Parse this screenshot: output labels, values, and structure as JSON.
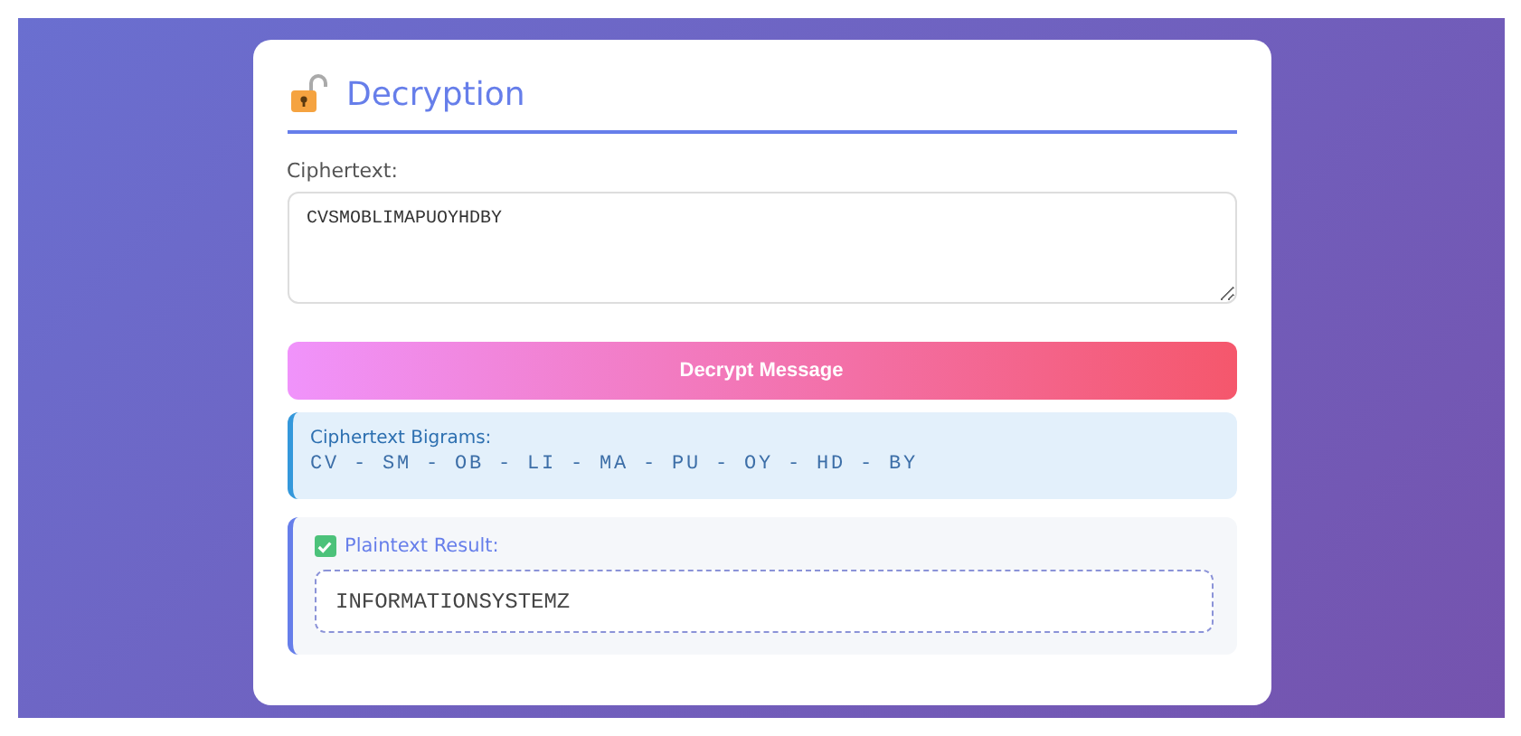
{
  "title": "Decryption",
  "ciphertext": {
    "label": "Ciphertext:",
    "value": "CVSMOBLIMAPUOYHDBY"
  },
  "button": "Decrypt Message",
  "bigrams": {
    "label": "Ciphertext Bigrams:",
    "text": "CV - SM - OB - LI - MA - PU - OY - HD - BY"
  },
  "result": {
    "label": "Plaintext Result:",
    "checked": true,
    "value": "INFORMATIONSYSTEMZ"
  }
}
